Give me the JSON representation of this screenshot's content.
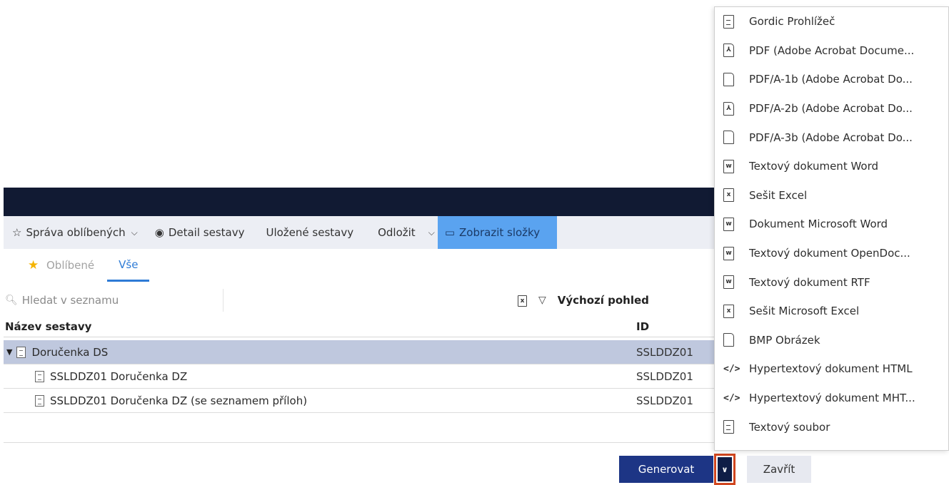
{
  "toolbar": {
    "favorites_label": "Správa oblíbených",
    "detail_label": "Detail sestavy",
    "saved_label": "Uložené sestavy",
    "postpone_label": "Odložit",
    "show_folders_label": "Zobrazit složky"
  },
  "tabs": [
    {
      "label": "Oblíbené"
    },
    {
      "label": "Vše"
    }
  ],
  "search": {
    "placeholder": "Hledat v seznamu",
    "view_label": "Výchozí pohled"
  },
  "table": {
    "columns": [
      "Název sestavy",
      "ID"
    ],
    "rows": [
      {
        "name": "Doručenka DS",
        "id": "SSLDDZ01"
      },
      {
        "name": "SSLDDZ01 Doručenka DZ",
        "id": "SSLDDZ01"
      },
      {
        "name": "SSLDDZ01 Doručenka DZ (se seznamem příloh)",
        "id": "SSLDDZ01"
      }
    ]
  },
  "footer": {
    "generate_label": "Generovat",
    "close_label": "Zavřít"
  },
  "menu": {
    "items": [
      {
        "label": "Gordic Prohlížeč",
        "icon": "document-lines-icon"
      },
      {
        "label": "PDF (Adobe Acrobat Docume...",
        "icon": "pdf-icon"
      },
      {
        "label": "PDF/A-1b (Adobe Acrobat Do...",
        "icon": "file-icon"
      },
      {
        "label": "PDF/A-2b (Adobe Acrobat Do...",
        "icon": "pdf-icon"
      },
      {
        "label": "PDF/A-3b (Adobe Acrobat Do...",
        "icon": "file-icon"
      },
      {
        "label": "Textový dokument Word",
        "icon": "word-icon"
      },
      {
        "label": "Sešit Excel",
        "icon": "excel-icon"
      },
      {
        "label": "Dokument Microsoft Word",
        "icon": "word-icon"
      },
      {
        "label": "Textový dokument OpenDoc...",
        "icon": "word-icon"
      },
      {
        "label": "Textový dokument RTF",
        "icon": "word-icon"
      },
      {
        "label": "Sešit Microsoft Excel",
        "icon": "excel-icon"
      },
      {
        "label": "BMP Obrázek",
        "icon": "file-icon"
      },
      {
        "label": "Hypertextový dokument HTML",
        "icon": "code-icon"
      },
      {
        "label": "Hypertextový dokument MHT...",
        "icon": "code-icon"
      },
      {
        "label": "Textový soubor",
        "icon": "document-lines-icon"
      }
    ]
  }
}
